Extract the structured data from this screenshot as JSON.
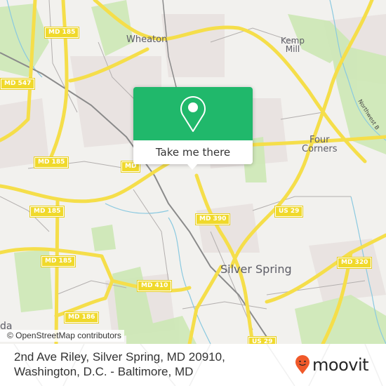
{
  "map": {
    "place_labels": [
      {
        "id": "wheaton",
        "text": "Wheaton"
      },
      {
        "id": "kemp-mill",
        "text": "Kemp\nMill"
      },
      {
        "id": "four-corners",
        "text": "Four\nCorners"
      },
      {
        "id": "silver-spring",
        "text": "Silver Spring"
      },
      {
        "id": "bethesda-partial",
        "text": "da"
      }
    ],
    "road_shields": [
      {
        "id": "md185-top",
        "text": "MD 185"
      },
      {
        "id": "md547",
        "text": "MD 547"
      },
      {
        "id": "md185-mid",
        "text": "MD 185"
      },
      {
        "id": "md-partial",
        "text": "MD"
      },
      {
        "id": "md185-lower",
        "text": "MD 185"
      },
      {
        "id": "md185-bottom",
        "text": "MD 185"
      },
      {
        "id": "md390",
        "text": "MD 390"
      },
      {
        "id": "us29-right",
        "text": "US 29"
      },
      {
        "id": "md320",
        "text": "MD 320"
      },
      {
        "id": "md410",
        "text": "MD 410"
      },
      {
        "id": "md186",
        "text": "MD 186"
      },
      {
        "id": "us29-bottom",
        "text": "US 29"
      }
    ],
    "road_name_label": "Northwest B",
    "attribution": "© OpenStreetMap contributors",
    "colors": {
      "land": "#f2f1ee",
      "park": "#cde8b5",
      "urban": "#e9e3e1",
      "major_road": "#f5de4a",
      "minor_road": "#a9a5a5",
      "water": "#8ac9e0"
    }
  },
  "popup": {
    "icon": "location-pin-icon",
    "button_label": "Take me there",
    "color": "#20b86b"
  },
  "footer": {
    "address": "2nd Ave Riley, Silver Spring, MD 20910, Washington, D.C. - Baltimore, MD",
    "brand": "moovit",
    "brand_color": "#f0592a"
  }
}
